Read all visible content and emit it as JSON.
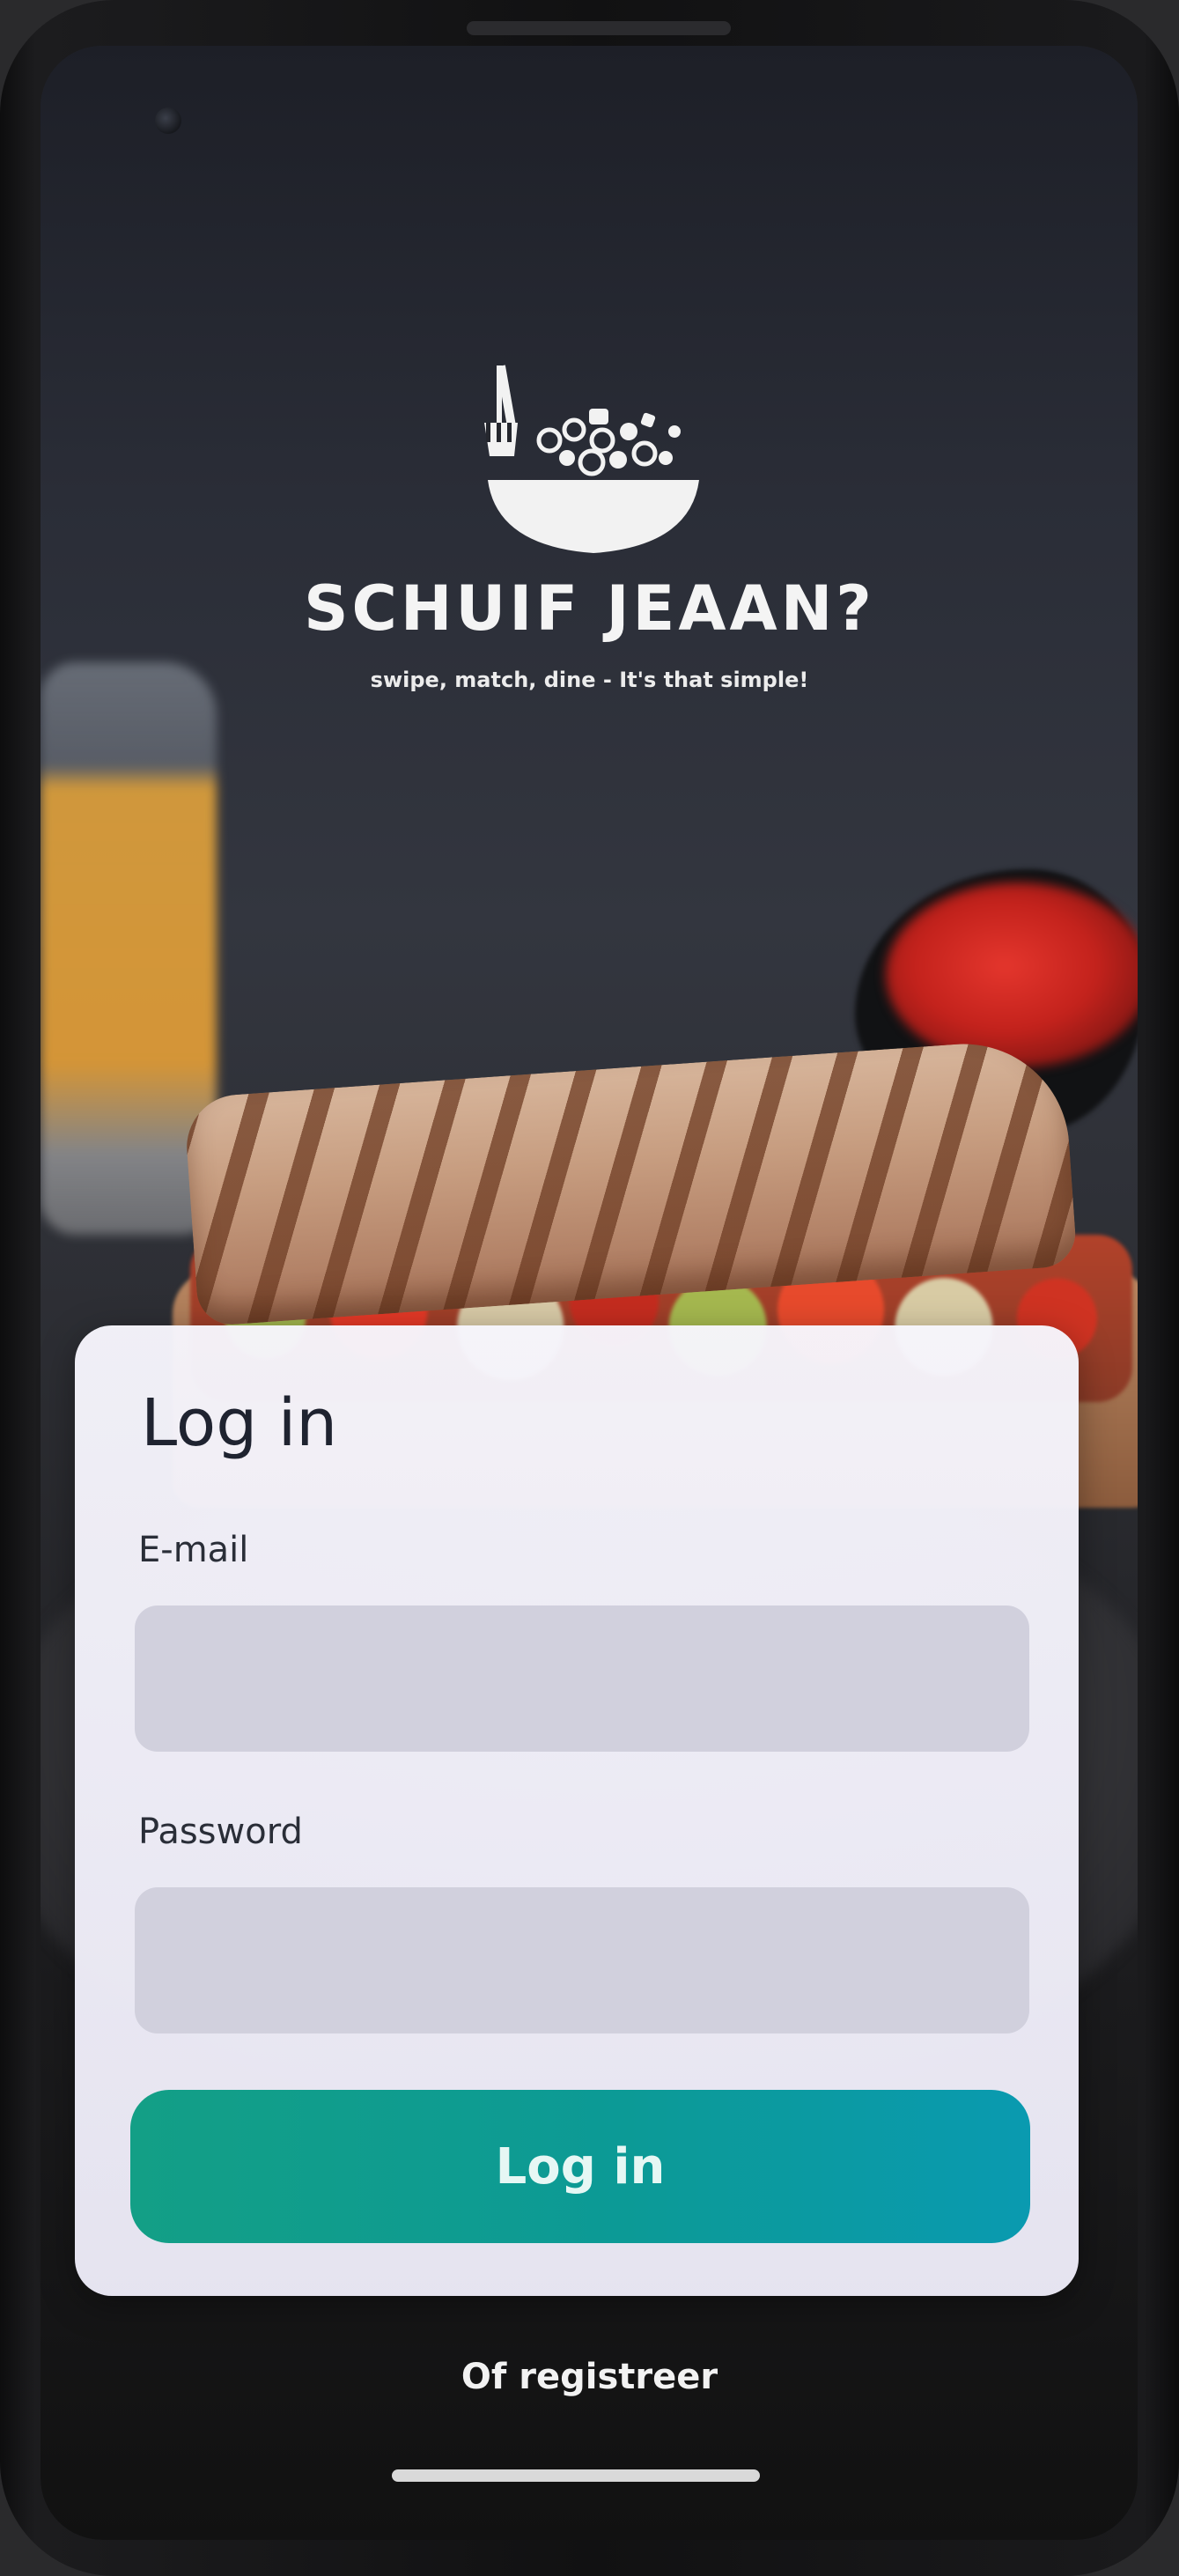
{
  "app": {
    "name": "SCHUIF JEAAN?",
    "tagline": "swipe, match, dine - It's that simple!",
    "logo_icon": "bowl-with-fork-icon"
  },
  "login": {
    "title": "Log in",
    "email_label": "E-mail",
    "email_value": "",
    "email_placeholder": "",
    "password_label": "Password",
    "password_value": "",
    "password_placeholder": "",
    "submit_label": "Log in"
  },
  "footer": {
    "register_label": "Of registreer"
  },
  "colors": {
    "accent": "#109c91",
    "card_background": "#efedf8",
    "input_background": "#d1d0dd"
  }
}
